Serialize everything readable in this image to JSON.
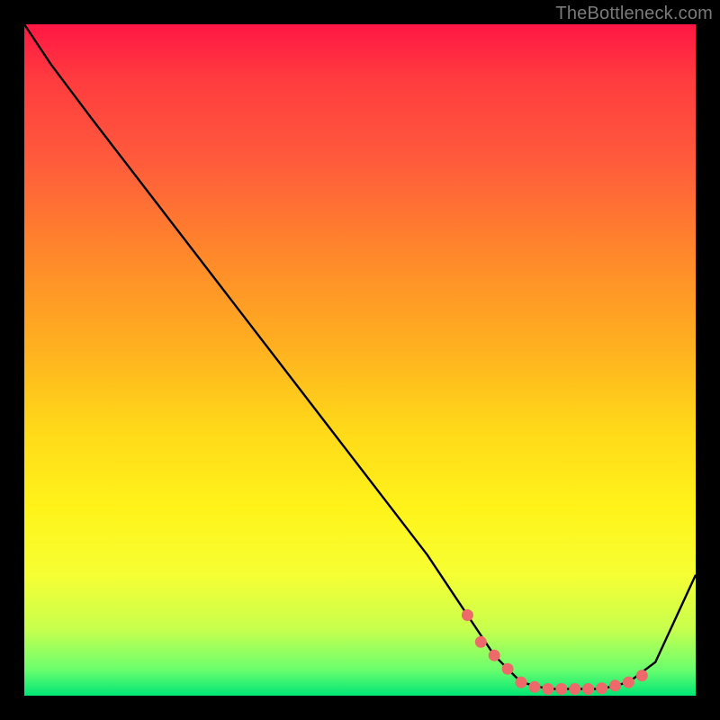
{
  "watermark": "TheBottleneck.com",
  "colors": {
    "frame": "#000000",
    "curve": "#000000",
    "marker": "#ee6a6a",
    "gradient_top": "#ff1744",
    "gradient_bottom": "#00e676"
  },
  "chart_data": {
    "type": "line",
    "title": "",
    "xlabel": "",
    "ylabel": "",
    "xlim": [
      0,
      100
    ],
    "ylim": [
      0,
      100
    ],
    "x": [
      0,
      4,
      10,
      20,
      30,
      40,
      50,
      60,
      66,
      70,
      74,
      78,
      82,
      86,
      90,
      94,
      100
    ],
    "values": [
      100,
      94,
      86,
      73,
      60,
      47,
      34,
      21,
      12,
      6,
      2,
      1,
      1,
      1,
      2,
      5,
      18
    ],
    "markers": {
      "x": [
        66,
        68,
        70,
        72,
        74,
        76,
        78,
        80,
        82,
        84,
        86,
        88,
        90,
        92
      ],
      "values": [
        12,
        8,
        6,
        4,
        2,
        1.3,
        1,
        1,
        1,
        1,
        1.1,
        1.5,
        2,
        3
      ]
    }
  }
}
